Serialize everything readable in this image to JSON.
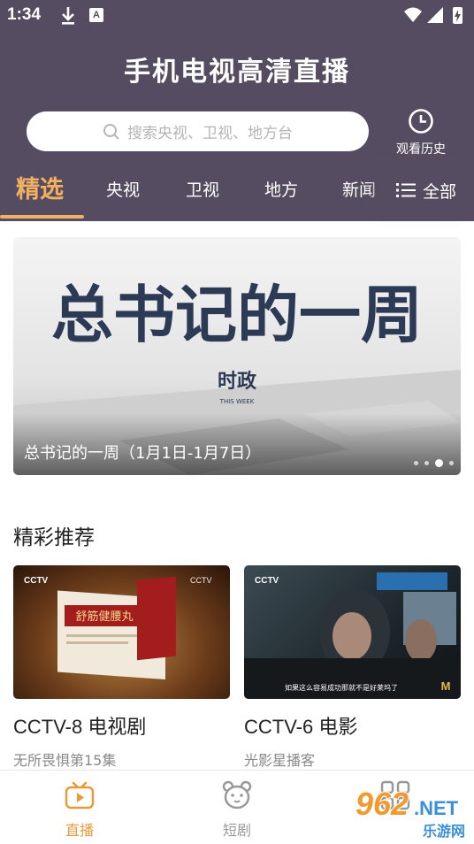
{
  "status_bar": {
    "time": "1:34",
    "a_badge": "A"
  },
  "header": {
    "title": "手机电视高清直播",
    "search": {
      "placeholder": "搜索央视、卫视、地方台"
    },
    "history_label": "观看历史"
  },
  "tabs": [
    {
      "label": "精选",
      "active": true
    },
    {
      "label": "央视"
    },
    {
      "label": "卫视"
    },
    {
      "label": "地方"
    },
    {
      "label": "新闻"
    }
  ],
  "all_label": "全部",
  "banner": {
    "caption": "总书记的一周（1月1日-1月7日）",
    "art_title": "总书记的一周",
    "logo_text": "时政",
    "logo_sub": "THIS WEEK",
    "dot_count": 4,
    "active_dot": 3
  },
  "section": {
    "title": "精彩推荐",
    "cards": [
      {
        "title": "CCTV-8 电视剧",
        "subtitle": "无所畏惧第15集",
        "thumb_text": "舒筋健腰丸"
      },
      {
        "title": "CCTV-6 电影",
        "subtitle": "光影星播客",
        "thumb_text": "如果这么容易成功那就不是好莱坞了"
      }
    ]
  },
  "bottom_nav": [
    {
      "label": "直播",
      "icon": "tv-icon",
      "active": true
    },
    {
      "label": "短剧",
      "icon": "bear-icon"
    },
    {
      "label": "",
      "icon": "grid-icon"
    }
  ],
  "watermark": {
    "number": "962",
    "suffix": ".NET",
    "sub": "乐游网"
  },
  "colors": {
    "header_bg": "#564c61",
    "accent": "#f2b160",
    "nav_active": "#e59a3b"
  }
}
